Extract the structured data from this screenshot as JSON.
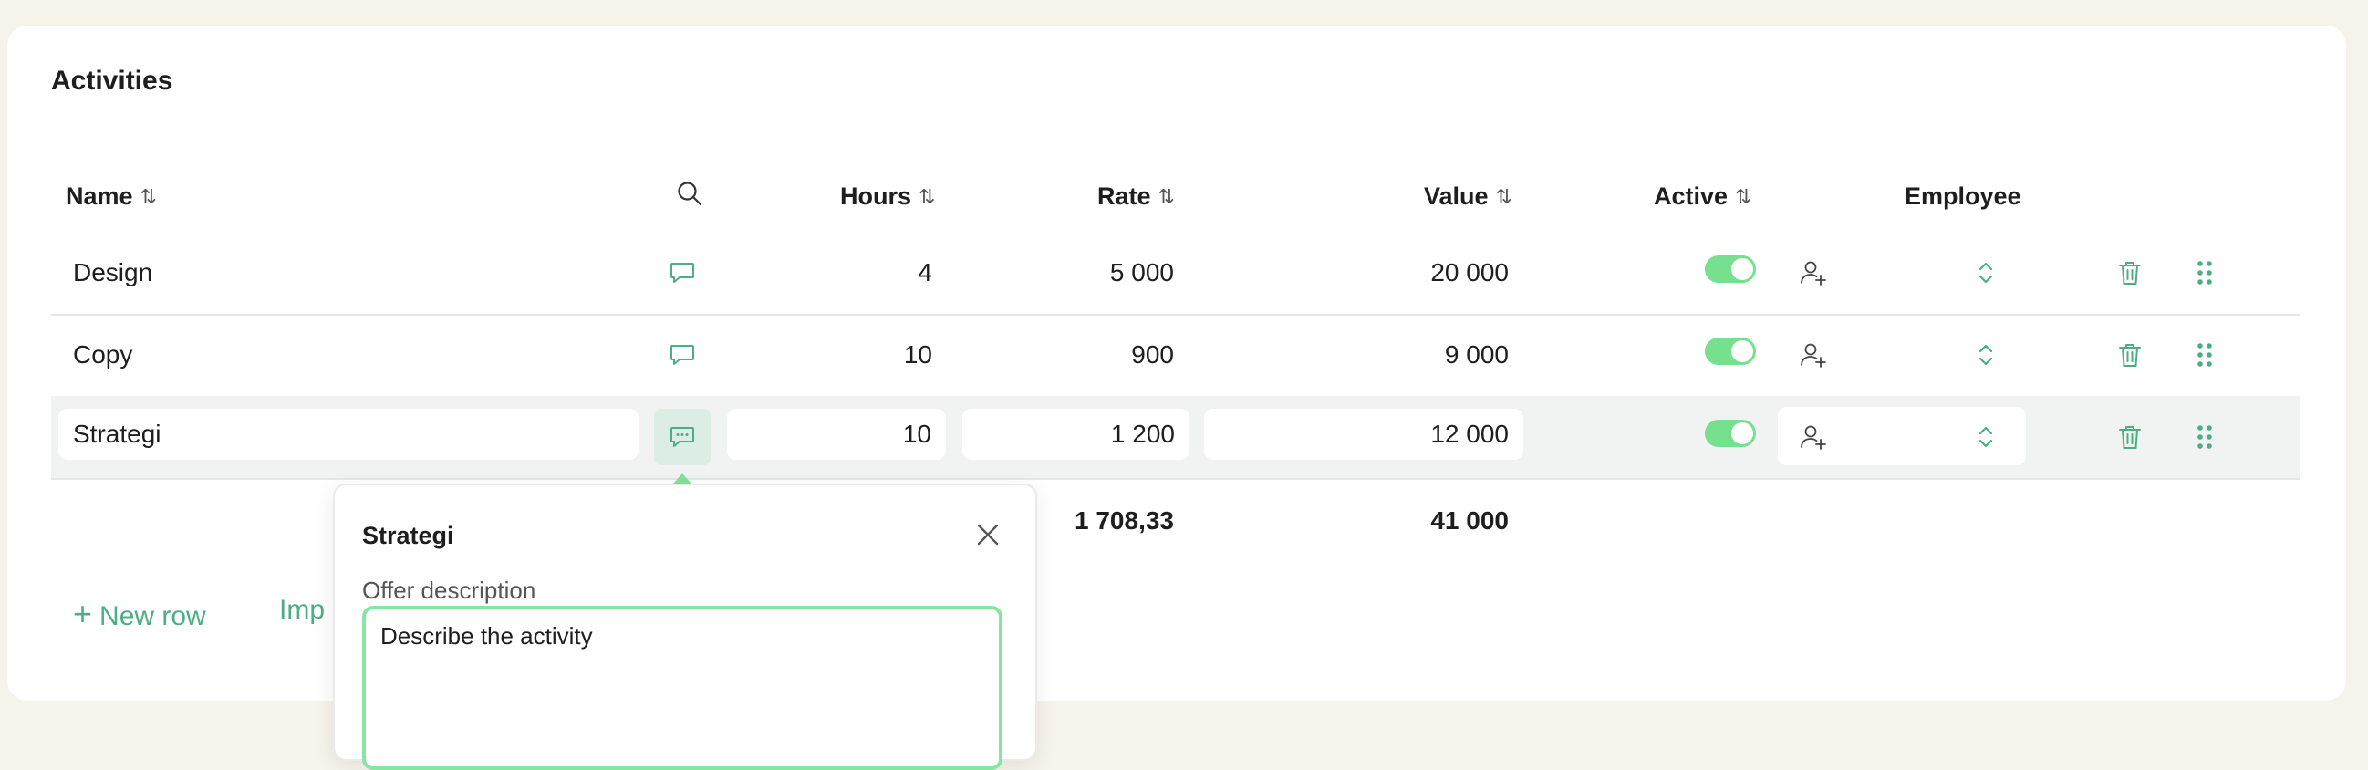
{
  "section": {
    "title": "Activities"
  },
  "columns": {
    "name": "Name",
    "hours": "Hours",
    "rate": "Rate",
    "value": "Value",
    "active": "Active",
    "employee": "Employee",
    "sort_glyph": "⇅"
  },
  "rows": [
    {
      "name": "Design",
      "hours": "4",
      "rate": "5 000",
      "value": "20 000",
      "active": true
    },
    {
      "name": "Copy",
      "hours": "10",
      "rate": "900",
      "value": "9 000",
      "active": true
    },
    {
      "name": "Strategi",
      "hours": "10",
      "rate": "1 200",
      "value": "12 000",
      "active": true
    }
  ],
  "totals": {
    "rate": "1 708,33",
    "value": "41 000"
  },
  "actions": {
    "new_row": "New row",
    "new_row_glyph": "+",
    "import": "Imp"
  },
  "popup": {
    "title": "Strategi",
    "label": "Offer description",
    "value": "Describe the activity"
  },
  "colors": {
    "accent": "#4caf83",
    "toggle_on": "#76e08f",
    "focus_border": "#84e6a0"
  },
  "icons": [
    "search-icon",
    "comment-icon",
    "add-user-icon",
    "chevron-up-down-icon",
    "trash-icon",
    "drag-handle-icon",
    "close-icon"
  ]
}
